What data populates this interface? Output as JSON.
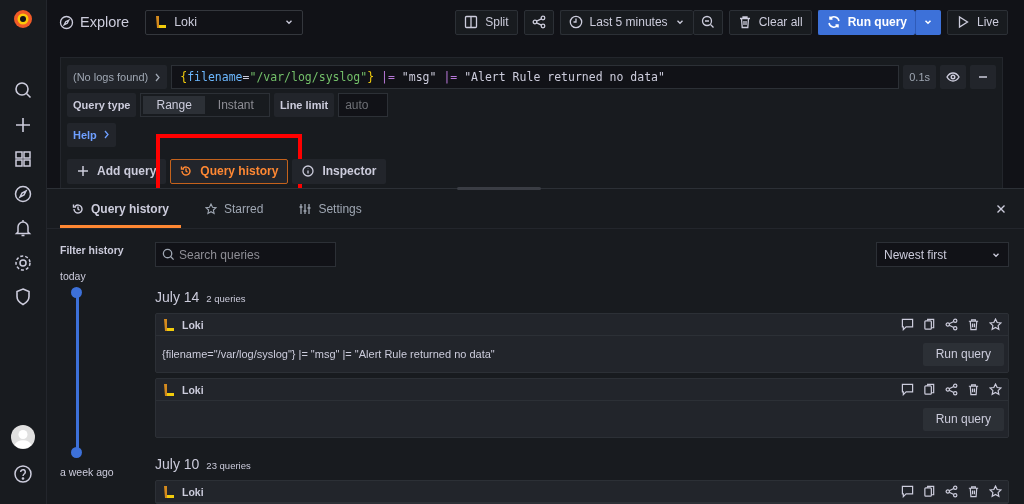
{
  "header": {
    "title": "Explore",
    "datasource": "Loki"
  },
  "toolbar": {
    "split": "Split",
    "time_range": "Last 5 minutes",
    "clear": "Clear all",
    "run": "Run query",
    "live": "Live"
  },
  "query": {
    "status": "(No logs found)",
    "tokens": [
      {
        "kind": "brace",
        "text": "{"
      },
      {
        "kind": "label",
        "text": "filename"
      },
      {
        "kind": "op",
        "text": "="
      },
      {
        "kind": "string",
        "text": "\"/var/log/syslog\""
      },
      {
        "kind": "brace",
        "text": "}"
      },
      {
        "kind": "pipe",
        "text": " |="
      },
      {
        "kind": "plain",
        "text": " \"msg\" "
      },
      {
        "kind": "pipe",
        "text": "|="
      },
      {
        "kind": "plain",
        "text": " \"Alert Rule returned no data\""
      }
    ],
    "duration": "0.1s",
    "query_type_label": "Query type",
    "query_types": [
      {
        "label": "Range",
        "selected": true
      },
      {
        "label": "Instant",
        "selected": false
      }
    ],
    "line_limit_label": "Line limit",
    "line_limit_placeholder": "auto",
    "help": "Help"
  },
  "actions": [
    {
      "kind": "add",
      "label": "Add query",
      "active": false,
      "highlighted": false
    },
    {
      "kind": "history",
      "label": "Query history",
      "active": true,
      "highlighted": true
    },
    {
      "kind": "inspector",
      "label": "Inspector",
      "active": false,
      "highlighted": false
    }
  ],
  "drawer": {
    "tabs": [
      {
        "kind": "history",
        "label": "Query history",
        "selected": true
      },
      {
        "kind": "star",
        "label": "Starred",
        "selected": false
      },
      {
        "kind": "settings",
        "label": "Settings",
        "selected": false
      }
    ],
    "filter_title": "Filter history",
    "range_top": "today",
    "range_bottom": "a week ago",
    "range_handles": [
      {
        "level": 1
      },
      {
        "level": 0
      }
    ],
    "search_placeholder": "Search queries",
    "sort": "Newest first",
    "groups": [
      {
        "date": "July 14",
        "count": "2 queries",
        "cards": [
          {
            "datasource": "Loki",
            "query": "{filename=\"/var/log/syslog\"} |= \"msg\" |= \"Alert Rule returned no data\"",
            "button": "Run query"
          },
          {
            "datasource": "Loki",
            "button": "Run query"
          }
        ]
      },
      {
        "date": "July 10",
        "count": "23 queries",
        "cards": [
          {
            "datasource": "Loki"
          }
        ]
      }
    ]
  }
}
